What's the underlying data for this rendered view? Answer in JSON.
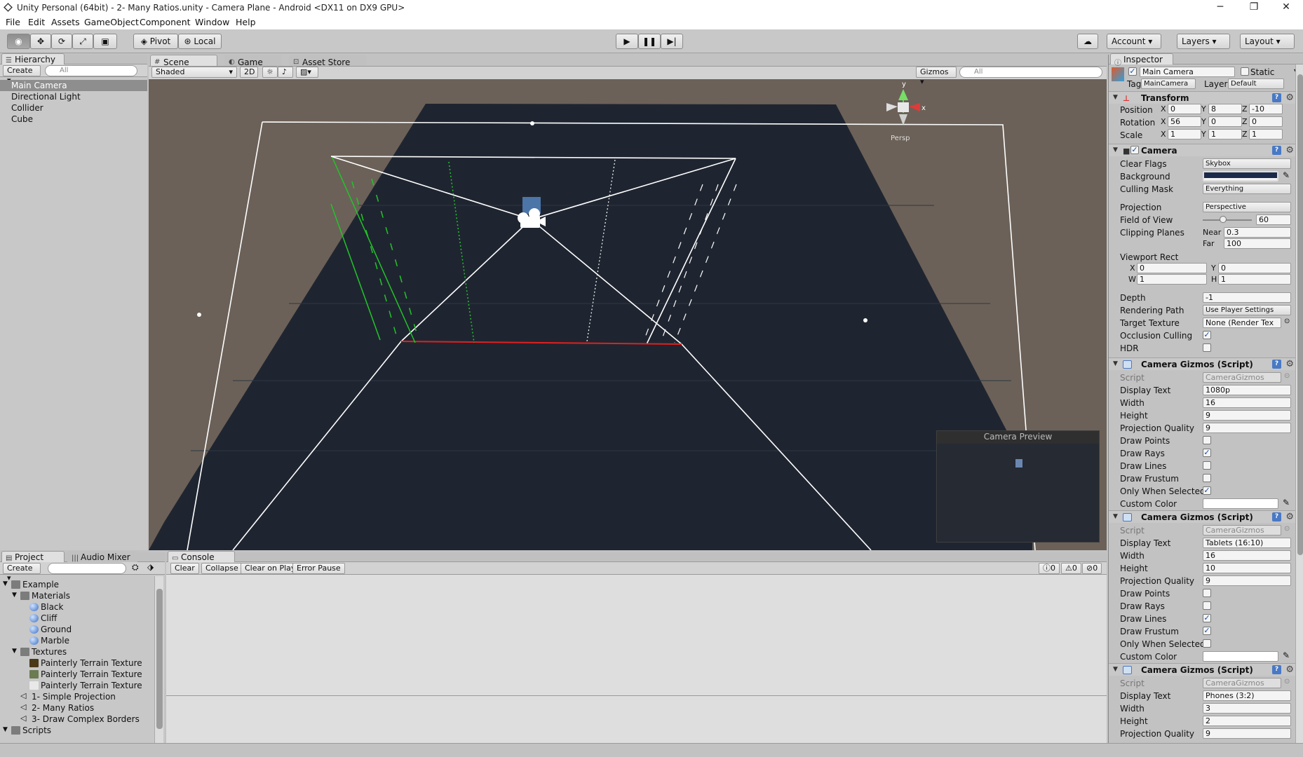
{
  "window": {
    "title": "Unity Personal (64bit) - 2- Many Ratios.unity - Camera Plane - Android <DX11 on DX9 GPU>"
  },
  "menu": [
    "File",
    "Edit",
    "Assets",
    "GameObject",
    "Component",
    "Window",
    "Help"
  ],
  "toolbar": {
    "pivot": "Pivot",
    "local": "Local",
    "account": "Account",
    "layers": "Layers",
    "layout": "Layout"
  },
  "hierarchy": {
    "tab": "Hierarchy",
    "create": "Create",
    "search_placeholder": "All",
    "items": [
      "Main Camera",
      "Directional Light",
      "Collider",
      "Cube"
    ]
  },
  "scene": {
    "tabs": [
      "Scene",
      "Game",
      "Asset Store"
    ],
    "shading": "Shaded",
    "mode2d": "2D",
    "gizmos": "Gizmos",
    "search_placeholder": "All",
    "persp": "Persp",
    "axis_y": "y",
    "axis_x": "x",
    "preview_title": "Camera Preview"
  },
  "inspector": {
    "tab": "Inspector",
    "object_name": "Main Camera",
    "static": "Static",
    "tag_label": "Tag",
    "tag": "MainCamera",
    "layer_label": "Layer",
    "layer": "Default",
    "transform": {
      "title": "Transform",
      "position_label": "Position",
      "rotation_label": "Rotation",
      "scale_label": "Scale",
      "position": {
        "x": "0",
        "y": "8",
        "z": "-10"
      },
      "rotation": {
        "x": "56",
        "y": "0",
        "z": "0"
      },
      "scale": {
        "x": "1",
        "y": "1",
        "z": "1"
      }
    },
    "camera": {
      "title": "Camera",
      "clear_flags_label": "Clear Flags",
      "clear_flags": "Skybox",
      "background_label": "Background",
      "background_color": "#1b2a4a",
      "culling_mask_label": "Culling Mask",
      "culling_mask": "Everything",
      "projection_label": "Projection",
      "projection": "Perspective",
      "fov_label": "Field of View",
      "fov": "60",
      "clipping_label": "Clipping Planes",
      "near_label": "Near",
      "near": "0.3",
      "far_label": "Far",
      "far": "100",
      "viewport_label": "Viewport Rect",
      "vp_x": "0",
      "vp_y": "0",
      "vp_w": "1",
      "vp_h": "1",
      "depth_label": "Depth",
      "depth": "-1",
      "rendering_path_label": "Rendering Path",
      "rendering_path": "Use Player Settings",
      "target_texture_label": "Target Texture",
      "target_texture": "None (Render Tex",
      "occlusion_label": "Occlusion Culling",
      "hdr_label": "HDR"
    },
    "gizmos_title": "Camera Gizmos (Script)",
    "labels": {
      "script": "Script",
      "display_text": "Display Text",
      "width": "Width",
      "height": "Height",
      "projection_quality": "Projection Quality",
      "draw_points": "Draw Points",
      "draw_rays": "Draw Rays",
      "draw_lines": "Draw Lines",
      "draw_frustum": "Draw Frustum",
      "only_when_selected": "Only When Selected",
      "custom_color": "Custom Color"
    },
    "script_value": "CameraGizmos",
    "gizmos": [
      {
        "display_text": "1080p",
        "width": "16",
        "height": "9",
        "projection_quality": "9"
      },
      {
        "display_text": "Tablets (16:10)",
        "width": "16",
        "height": "10",
        "projection_quality": "9"
      },
      {
        "display_text": "Phones (3:2)",
        "width": "3",
        "height": "2",
        "projection_quality": "9"
      }
    ]
  },
  "project": {
    "tabs": [
      "Project",
      "Audio Mixer"
    ],
    "create": "Create",
    "tree": [
      "Example",
      "Materials",
      "Black",
      "Cliff",
      "Ground",
      "Marble",
      "Textures",
      "Painterly Terrain Texture",
      "Painterly Terrain Texture",
      "Painterly Terrain Texture",
      "1- Simple Projection",
      "2- Many Ratios",
      "3- Draw Complex Borders",
      "Scripts"
    ]
  },
  "console": {
    "tab": "Console",
    "buttons": [
      "Clear",
      "Collapse",
      "Clear on Play",
      "Error Pause"
    ],
    "counts": [
      "0",
      "0",
      "0"
    ]
  }
}
